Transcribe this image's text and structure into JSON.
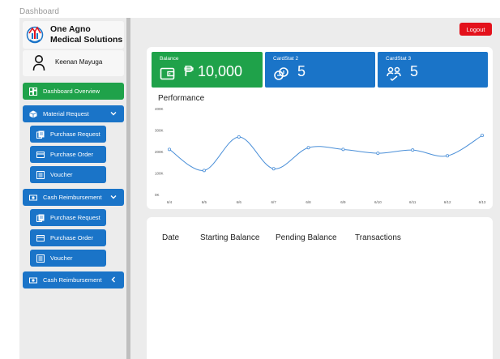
{
  "frame_title": "Dashboard",
  "brand": {
    "name_line1": "One Agno",
    "name_line2": "Medical Solutions"
  },
  "user": {
    "name": "Keenan Mayuga"
  },
  "nav": {
    "dashboard": "Dashboard Overview",
    "material_request": "Material Request",
    "mr_purchase_request": "Purchase Request",
    "mr_purchase_order": "Purchase Order",
    "mr_voucher": "Voucher",
    "cash_reimbursement": "Cash Reimbursement",
    "cr_purchase_request": "Purchase Request",
    "cr_purchase_order": "Purchase Order",
    "cr_voucher": "Voucher",
    "cash_reimbursement_2": "Cash Reimbursement"
  },
  "header": {
    "logout": "Logout"
  },
  "stats": [
    {
      "label": "Balance",
      "value": "₱ 10,000",
      "color": "#1fa24a",
      "icon": "wallet-icon"
    },
    {
      "label": "CardStat 2",
      "value": "5",
      "color": "#1a74c8",
      "icon": "coins-icon"
    },
    {
      "label": "CardStat 3",
      "value": "5",
      "color": "#1a74c8",
      "icon": "people-icon"
    }
  ],
  "performance": {
    "title": "Performance"
  },
  "chart_data": {
    "type": "line",
    "title": "Performance",
    "categories": [
      "6/4",
      "6/5",
      "6/6",
      "6/7",
      "6/8",
      "6/9",
      "6/10",
      "6/11",
      "6/12",
      "6/13"
    ],
    "series": [
      {
        "values": [
          210000,
          112000,
          268000,
          120000,
          218000,
          210000,
          192000,
          207000,
          180000,
          275000
        ]
      }
    ],
    "y_ticks": [
      "0K",
      "100K",
      "200K",
      "300K",
      "400K"
    ],
    "ylim": [
      0,
      400000
    ],
    "grid": false,
    "color": "#4a8fd8"
  },
  "table": {
    "columns": [
      "Date",
      "Starting Balance",
      "Pending Balance",
      "Transactions"
    ]
  }
}
